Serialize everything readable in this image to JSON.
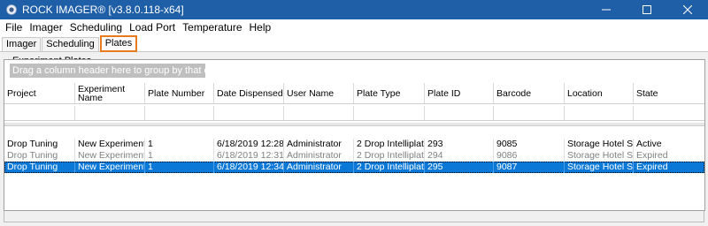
{
  "window": {
    "title": "ROCK IMAGER® [v3.8.0.118-x64]",
    "icons": {
      "app": "rock-imager-app-icon",
      "minimize": "minimize-icon",
      "maximize": "maximize-icon",
      "close": "close-icon"
    },
    "accent_color": "#1f5fa8"
  },
  "menu": [
    "File",
    "Imager",
    "Scheduling",
    "Load Port",
    "Temperature",
    "Help"
  ],
  "tabs": [
    {
      "label": "Imager",
      "selected": false
    },
    {
      "label": "Scheduling",
      "selected": false
    },
    {
      "label": "Plates",
      "selected": true
    }
  ],
  "highlight_color": "#e87b1f",
  "plates": {
    "group_title": "Experiment Plates",
    "group_by_hint": "Drag a column header here to group by that column.",
    "columns": [
      "Project",
      "Experiment Name",
      "Plate Number",
      "Date Dispensed",
      "User Name",
      "Plate Type",
      "Plate ID",
      "Barcode",
      "Location",
      "State"
    ],
    "rows": [
      {
        "style": "active",
        "cells": [
          "Drop Tuning",
          "New Experiment",
          "1",
          "6/18/2019  12:28:...",
          "Administrator",
          "2 Drop Intelliplat...",
          "293",
          "9085",
          "Storage Hotel  S...",
          "Active"
        ]
      },
      {
        "style": "expired",
        "cells": [
          "Drop Tuning",
          "New Experiment...",
          "1",
          "6/18/2019  12:31:...",
          "Administrator",
          "2 Drop Intelliplat...",
          "294",
          "9086",
          "Storage Hotel  S...",
          "Expired"
        ]
      },
      {
        "style": "selected",
        "cells": [
          "Drop Tuning",
          "New Experiment...",
          "1",
          "6/18/2019  12:34:...",
          "Administrator",
          "2 Drop Intelliplat...",
          "295",
          "9087",
          "Storage Hotel  S...",
          "Expired"
        ]
      }
    ],
    "selection_color": "#0a78d7"
  }
}
